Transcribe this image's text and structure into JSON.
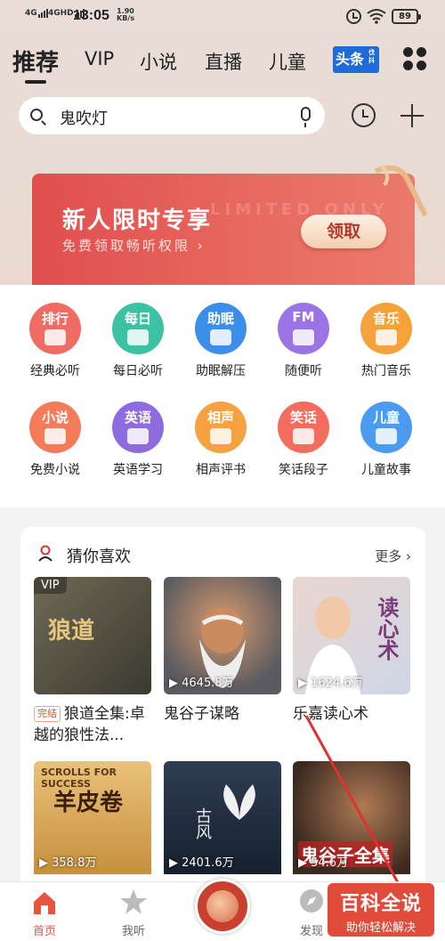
{
  "status_bar": {
    "signal1": "4G",
    "signal2": "4GHD",
    "time": "13:05",
    "speed_value": "1.90",
    "speed_unit": "KB/s",
    "battery": "89"
  },
  "tabs": [
    {
      "label": "推荐",
      "active": true
    },
    {
      "label": "VIP"
    },
    {
      "label": "小说"
    },
    {
      "label": "直播"
    },
    {
      "label": "儿童"
    }
  ],
  "toutiao": {
    "label": "头条",
    "small": "伐抖"
  },
  "search": {
    "value": "鬼吹灯"
  },
  "banner": {
    "ghost_text": "LIMITED ONLY",
    "title": "新人限时专享",
    "subtitle": "免费领取畅听权限 ›",
    "button": "领取"
  },
  "categories": [
    {
      "icon_text": "排行",
      "label": "经典必听",
      "color": "#f06b63"
    },
    {
      "icon_text": "每日",
      "label": "每日必听",
      "color": "#3cc2a2"
    },
    {
      "icon_text": "助眠",
      "label": "助眠解压",
      "color": "#3b8fe8"
    },
    {
      "icon_text": "FM",
      "label": "随便听",
      "color": "#9b73e4"
    },
    {
      "icon_text": "音乐",
      "label": "热门音乐",
      "color": "#f5a23a"
    },
    {
      "icon_text": "小说",
      "label": "免费小说",
      "color": "#f47b5a"
    },
    {
      "icon_text": "英语",
      "label": "英语学习",
      "color": "#8f6be0"
    },
    {
      "icon_text": "相声",
      "label": "相声评书",
      "color": "#f5a13f"
    },
    {
      "icon_text": "笑话",
      "label": "笑话段子",
      "color": "#f36c5e"
    },
    {
      "icon_text": "儿童",
      "label": "儿童故事",
      "color": "#4b9cf0"
    }
  ],
  "recommend": {
    "title": "猜你喜欢",
    "more": "更多 ›",
    "cards": [
      {
        "vip": "VIP",
        "plays": "",
        "badge": "完结",
        "caption": "狼道全集:卓越的狼性法...",
        "cover": "狼道"
      },
      {
        "plays": "▶ 4645.8万",
        "caption": "鬼谷子谋略",
        "cover": ""
      },
      {
        "plays": "▶ 1624.6万",
        "caption": "乐嘉读心术",
        "cover": "读心术"
      },
      {
        "plays": "▶ 358.8万",
        "caption": "",
        "cover": "羊皮卷",
        "cover_sub": "SCROLLS FOR SUCCESS"
      },
      {
        "plays": "▶ 2401.6万",
        "caption": "",
        "cover": "古风"
      },
      {
        "plays": "▶ 54.6万",
        "caption": "",
        "cover": "鬼谷子全集"
      }
    ]
  },
  "bottom_nav": [
    {
      "label": "首页",
      "active": true
    },
    {
      "label": "我听"
    },
    {
      "label": "发现"
    }
  ],
  "watermark": {
    "big": "百科全说",
    "small": "助你轻松解决"
  }
}
